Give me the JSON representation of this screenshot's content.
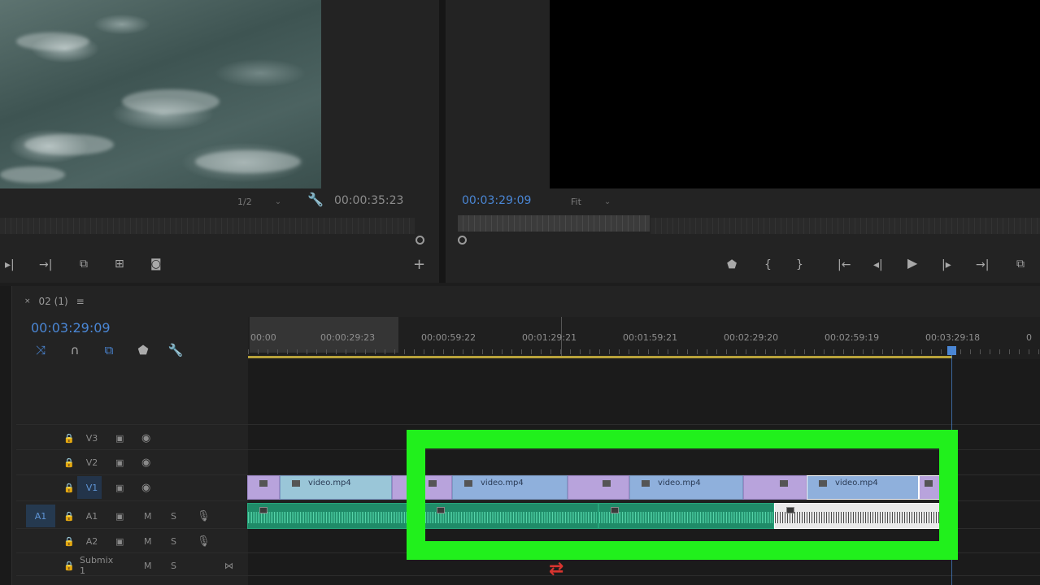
{
  "source_monitor": {
    "zoom": "1/2",
    "timecode": "00:00:35:23"
  },
  "program_monitor": {
    "timecode": "00:03:29:09",
    "fit": "Fit"
  },
  "timeline": {
    "sequence_name": "02 (1)",
    "timecode": "00:03:29:09",
    "ruler_ticks": [
      "00:00",
      "00:00:29:23",
      "00:00:59:22",
      "00:01:29:21",
      "00:01:59:21",
      "00:02:29:20",
      "00:02:59:19",
      "00:03:29:18",
      "0"
    ],
    "tracks": {
      "v3": "V3",
      "v2": "V2",
      "v1": "V1",
      "a1_source": "A1",
      "a1": "A1",
      "a2": "A2",
      "submix": "Submix 1",
      "mute": "M",
      "solo": "S"
    },
    "clips": [
      {
        "name": "video.mp4"
      },
      {
        "name": "video.mp4"
      },
      {
        "name": "video.mp4"
      },
      {
        "name": "video.mp4"
      }
    ]
  },
  "colors": {
    "timecode_blue": "#4a86d4",
    "highlight_green": "#21f01c",
    "video_clip_blue": "#8fb0dc",
    "video_clip_purple": "#b8a3dc",
    "audio_clip_green": "#1f8b68"
  }
}
